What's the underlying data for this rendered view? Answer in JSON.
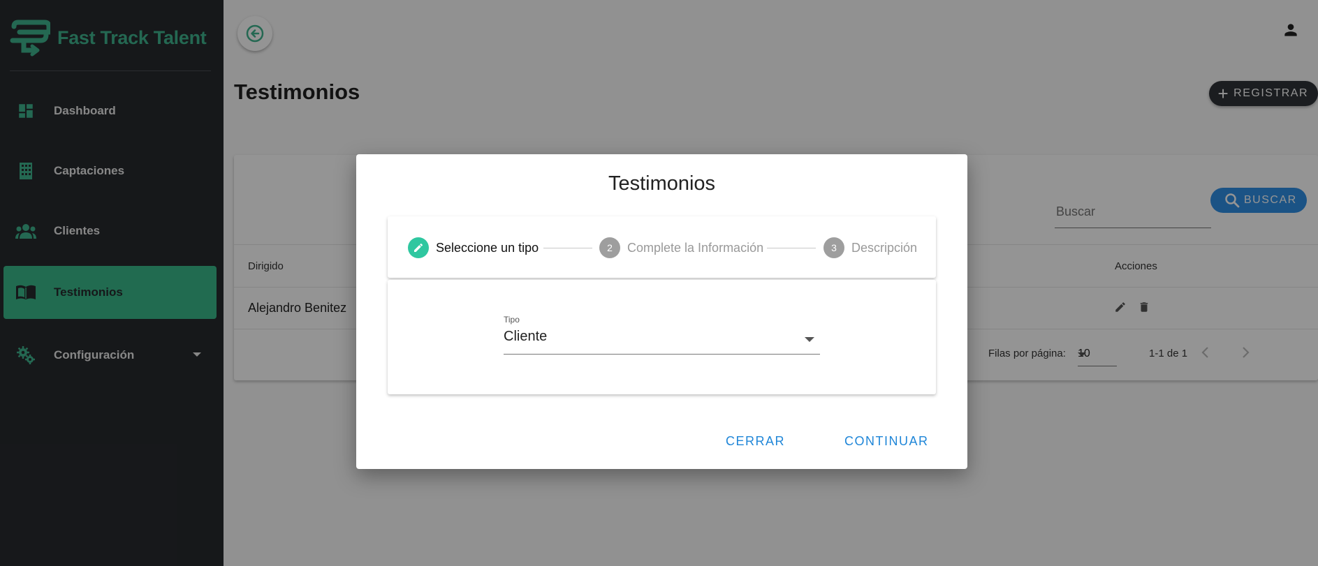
{
  "brand": {
    "name": "Fast Track Talent",
    "accent": "#3fb48e"
  },
  "sidebar": {
    "items": [
      {
        "label": "Dashboard",
        "icon": "dashboard-icon"
      },
      {
        "label": "Captaciones",
        "icon": "building-icon"
      },
      {
        "label": "Clientes",
        "icon": "people-icon"
      },
      {
        "label": "Testimonios",
        "icon": "book-icon",
        "active": true
      },
      {
        "label": "Configuración",
        "icon": "gear-icon"
      }
    ]
  },
  "header": {
    "back_icon": "arrow-left-circle-icon",
    "user_icon": "person-icon"
  },
  "page": {
    "title": "Testimonios",
    "register_label": "REGISTRAR"
  },
  "search": {
    "placeholder": "Buscar",
    "button_label": "BUSCAR"
  },
  "table": {
    "columns": [
      "Dirigido",
      "Acciones"
    ],
    "rows": [
      {
        "dirigido": "Alejandro Benitez"
      }
    ]
  },
  "pagination": {
    "rows_label": "Filas por página:",
    "rows_per_page": "10",
    "range": "1-1 de 1"
  },
  "dialog": {
    "title": "Testimonios",
    "steps": [
      {
        "number": "",
        "label": "Seleccione un tipo"
      },
      {
        "number": "2",
        "label": "Complete la Información"
      },
      {
        "number": "3",
        "label": "Descripción"
      }
    ],
    "field": {
      "label": "Tipo",
      "value": "Cliente"
    },
    "close_label": "CERRAR",
    "continue_label": "CONTINUAR"
  }
}
